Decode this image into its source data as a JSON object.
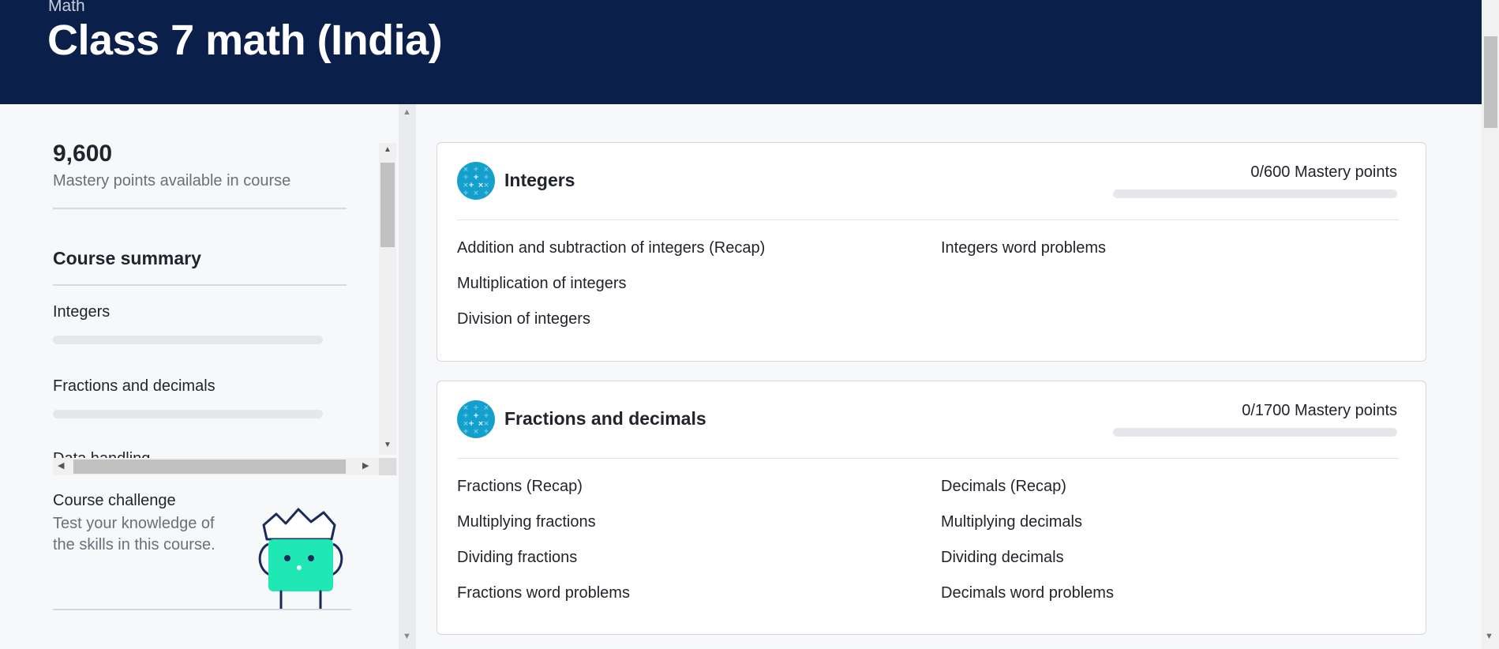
{
  "header": {
    "subject": "Math",
    "title": "Class 7 math (India)"
  },
  "sidebar": {
    "points": "9,600",
    "points_label": "Mastery points available in course",
    "summary_title": "Course summary",
    "units": [
      {
        "label": "Integers",
        "progress": 0
      },
      {
        "label": "Fractions and decimals",
        "progress": 0
      },
      {
        "label": "Data handling",
        "progress": 0
      }
    ],
    "challenge": {
      "title": "Course challenge",
      "description": "Test your knowledge of the skills in this course."
    }
  },
  "units": [
    {
      "title": "Integers",
      "mastery": "0/600 Mastery points",
      "progress": 0,
      "skills_left": [
        "Addition and subtraction of integers (Recap)",
        "Multiplication of integers",
        "Division of integers"
      ],
      "skills_right": [
        "Integers word problems"
      ]
    },
    {
      "title": "Fractions and decimals",
      "mastery": "0/1700 Mastery points",
      "progress": 0,
      "skills_left": [
        "Fractions (Recap)",
        "Multiplying fractions",
        "Dividing fractions",
        "Fractions word problems"
      ],
      "skills_right": [
        "Decimals (Recap)",
        "Multiplying decimals",
        "Dividing decimals",
        "Decimals word problems"
      ]
    }
  ],
  "colors": {
    "header_bg": "#0b1f4b",
    "unit_icon": "#14a0cd",
    "challenge_character": "#1fe8b4"
  }
}
